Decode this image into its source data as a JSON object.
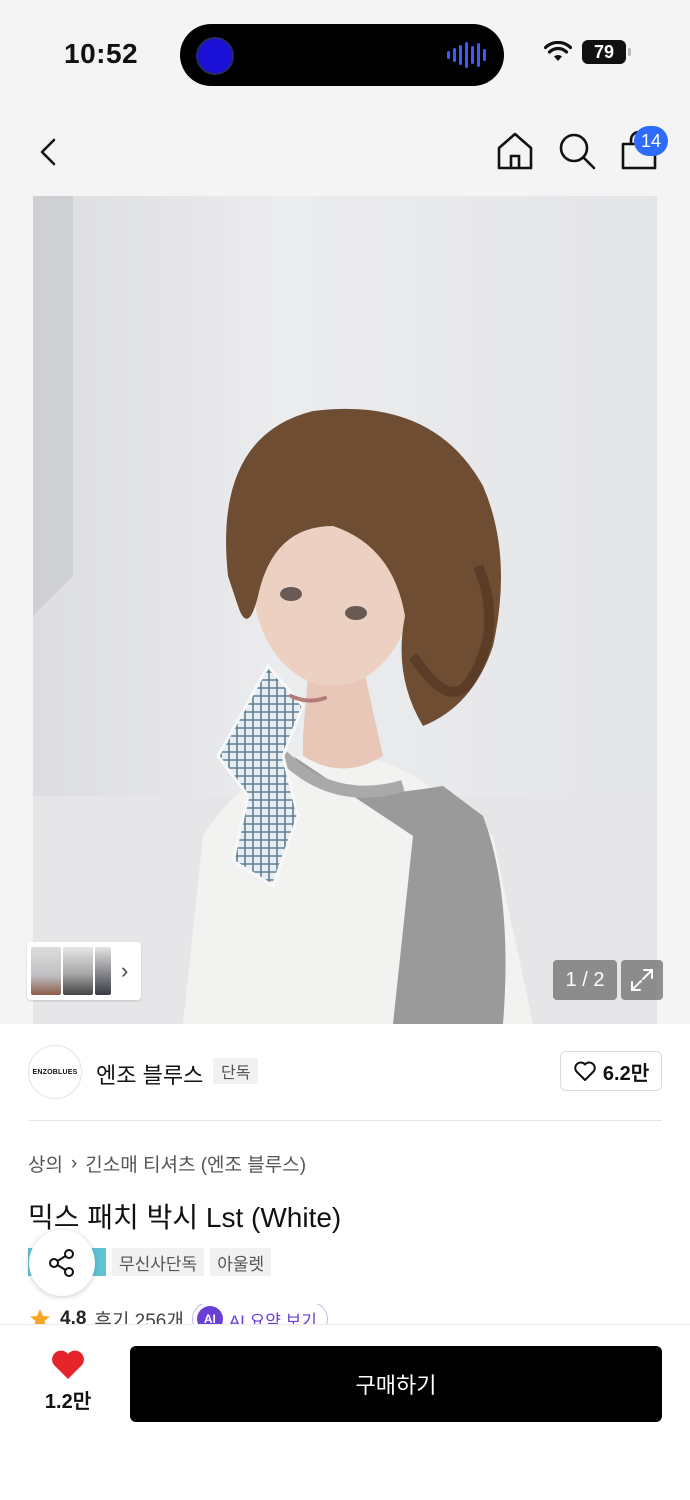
{
  "status_bar": {
    "time": "10:52",
    "battery": "79"
  },
  "header": {
    "cart_count": "14"
  },
  "gallery": {
    "page_indicator": "1 / 2"
  },
  "brand": {
    "logo_text": "ENZOBLUES",
    "name": "엔조 블루스",
    "exclusive_tag": "단독",
    "likes": "6.2만"
  },
  "product": {
    "breadcrumb": [
      "상의",
      "긴소매 티셔츠 (엔조 블루스)"
    ],
    "title": "믹스 패치 박시 Lst (White)",
    "tags": [
      "무신사단독",
      "아울렛"
    ],
    "rating": "4.8",
    "reviews": "후기 256개",
    "ai_badge": "AI",
    "ai_summary": "AI 요약 보기"
  },
  "bottom_bar": {
    "wish_count": "1.2만",
    "buy_label": "구매하기"
  },
  "colors": {
    "accent_blue": "#2f6bff",
    "heart_red": "#e5232a",
    "ai_purple": "#6b3fd6"
  }
}
